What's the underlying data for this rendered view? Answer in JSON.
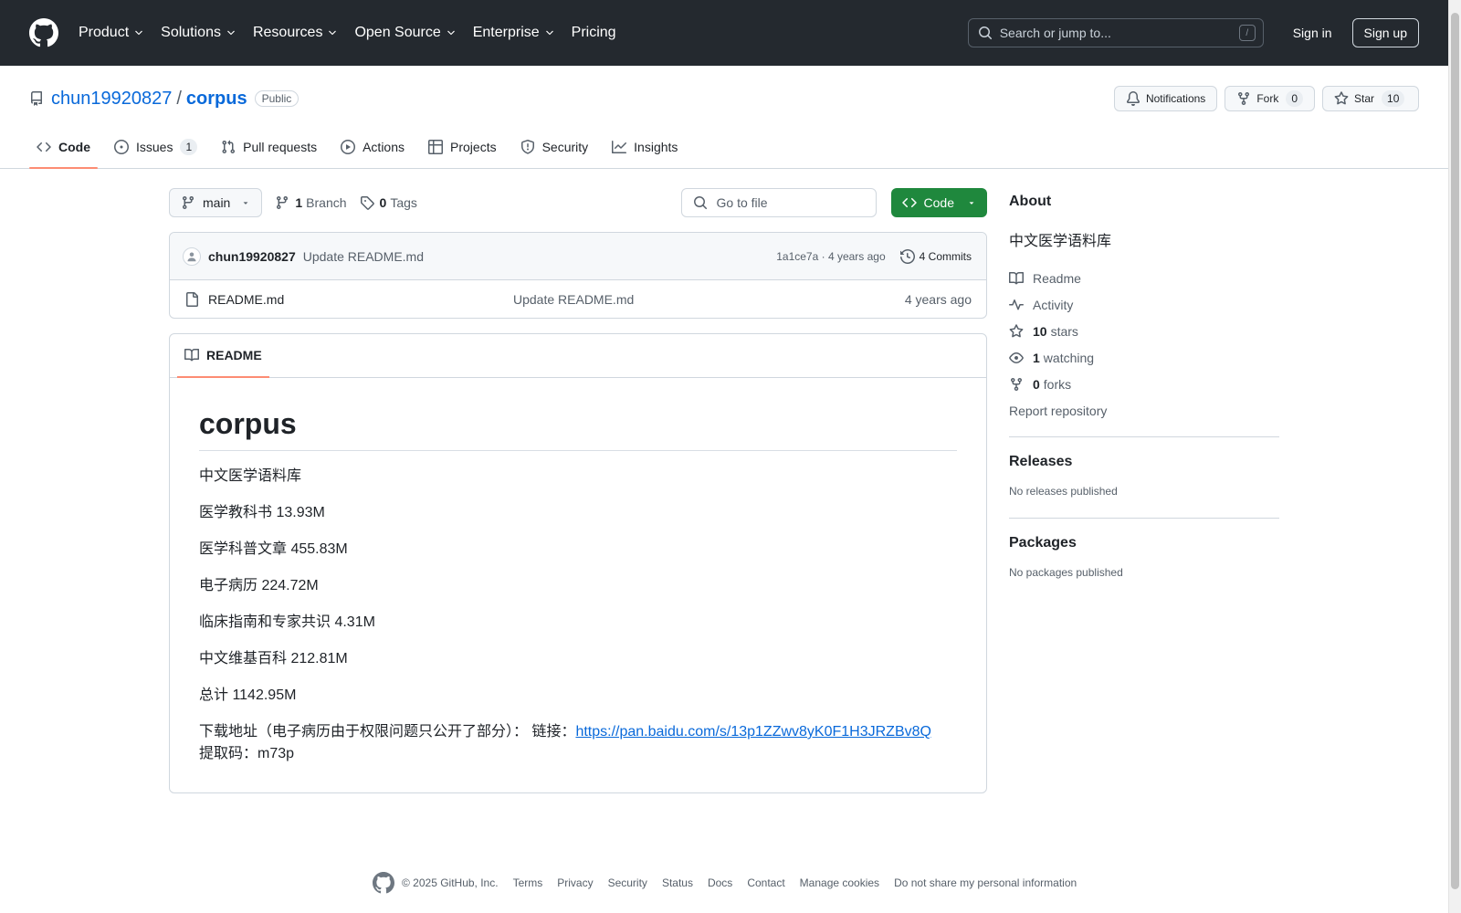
{
  "header": {
    "nav": [
      {
        "label": "Product",
        "dropdown": true
      },
      {
        "label": "Solutions",
        "dropdown": true
      },
      {
        "label": "Resources",
        "dropdown": true
      },
      {
        "label": "Open Source",
        "dropdown": true
      },
      {
        "label": "Enterprise",
        "dropdown": true
      },
      {
        "label": "Pricing",
        "dropdown": false
      }
    ],
    "search_placeholder": "Search or jump to...",
    "search_key": "/",
    "sign_in": "Sign in",
    "sign_up": "Sign up"
  },
  "repo": {
    "owner": "chun19920827",
    "separator": "/",
    "name": "corpus",
    "visibility": "Public",
    "notifications_label": "Notifications",
    "fork_label": "Fork",
    "fork_count": "0",
    "star_label": "Star",
    "star_count": "10"
  },
  "tabs": [
    {
      "label": "Code",
      "icon": "code-icon",
      "active": true
    },
    {
      "label": "Issues",
      "icon": "issue-icon",
      "count": "1"
    },
    {
      "label": "Pull requests",
      "icon": "pull-request-icon"
    },
    {
      "label": "Actions",
      "icon": "play-icon"
    },
    {
      "label": "Projects",
      "icon": "table-icon"
    },
    {
      "label": "Security",
      "icon": "shield-icon"
    },
    {
      "label": "Insights",
      "icon": "graph-icon"
    }
  ],
  "file_nav": {
    "branch": "main",
    "branch_count": "1",
    "branch_label": "Branch",
    "tag_count": "0",
    "tag_label": "Tags",
    "goto_placeholder": "Go to file",
    "code_button": "Code"
  },
  "latest_commit": {
    "author": "chun19920827",
    "message": "Update README.md",
    "hash_time": "1a1ce7a · 4 years ago",
    "commits_label": "4 Commits"
  },
  "files": [
    {
      "name": "README.md",
      "commit": "Update README.md",
      "age": "4 years ago"
    }
  ],
  "readme": {
    "tab_label": "README",
    "title": "corpus",
    "lines": [
      "中文医学语料库",
      "医学教科书 13.93M",
      "医学科普文章 455.83M",
      "电子病历 224.72M",
      "临床指南和专家共识 4.31M",
      "中文维基百科 212.81M",
      "总计 1142.95M"
    ],
    "download_prefix": "下载地址（电子病历由于权限问题只公开了部分）： 链接：",
    "download_url": "https://pan.baidu.com/s/13p1ZZwv8yK0F1H3JRZBv8Q",
    "extract_code": "提取码：m73p"
  },
  "about": {
    "title": "About",
    "description": "中文医学语料库",
    "readme": "Readme",
    "activity": "Activity",
    "stars_count": "10",
    "stars_label": "stars",
    "watching_count": "1",
    "watching_label": "watching",
    "forks_count": "0",
    "forks_label": "forks",
    "report": "Report repository"
  },
  "releases": {
    "title": "Releases",
    "note": "No releases published"
  },
  "packages": {
    "title": "Packages",
    "note": "No packages published"
  },
  "footer": {
    "copyright": "© 2025 GitHub, Inc.",
    "links": [
      "Terms",
      "Privacy",
      "Security",
      "Status",
      "Docs",
      "Contact",
      "Manage cookies",
      "Do not share my personal information"
    ]
  },
  "colors": {
    "header_bg": "#24292f",
    "link": "#0969da",
    "primary_button": "#1f883d",
    "active_tab_underline": "#fd8c73"
  }
}
